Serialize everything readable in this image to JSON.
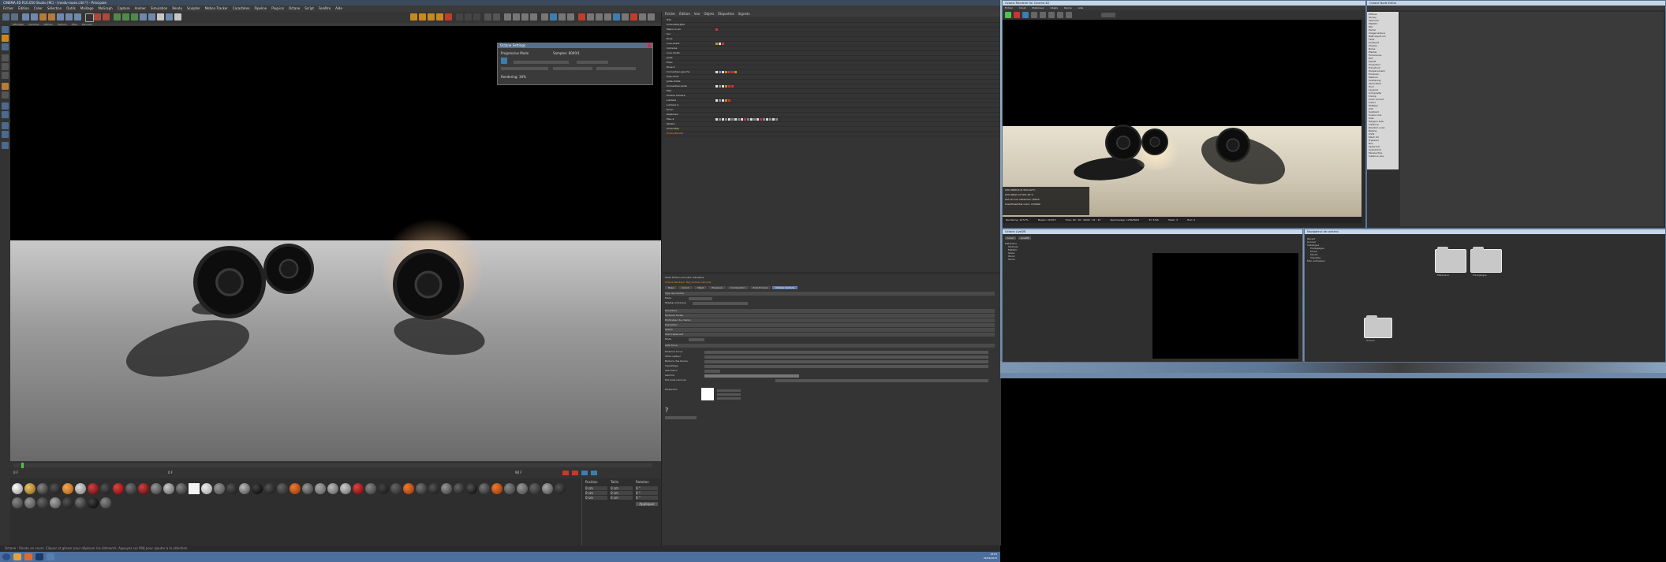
{
  "c4d": {
    "title": "CINEMA 4D R16.050 Studio (RC) - [rendu-roues.c4d *] - Principale",
    "menu": [
      "Fichier",
      "Édition",
      "Créer",
      "Sélection",
      "Outils",
      "Maillage",
      "MoGraph",
      "Capture",
      "Animer",
      "Simulation",
      "Rendu",
      "Sculpter",
      "Motion Tracker",
      "Caractères",
      "Pipeline",
      "Plug-ins",
      "Octane",
      "Script",
      "Fenêtre",
      "Aide"
    ],
    "viewport_menu": [
      "Affichage",
      "Caméras",
      "Afficher",
      "Options",
      "Filtre",
      "Panneau"
    ],
    "status": "Octane : Rendu en cours. Cliquer et glisser pour déplacer les éléments. Appuyez sur MAJ pour ajouter à la sélection.",
    "colors": {
      "accent": "#4d6a8c",
      "taskbar": "#4c6f9e"
    }
  },
  "render_dialog": {
    "title": "Octane Settings",
    "line1": "Progressive Mode",
    "line2": "Samples: 8000/1",
    "status": "Rendering: 30%"
  },
  "objects": {
    "menu": [
      "Fichier",
      "Édition",
      "Vue",
      "Objets",
      "Étiquettes",
      "Signets"
    ],
    "rows": [
      "Hdri",
      "OctaneDaylight",
      "Mains-ro-arr",
      "Sol",
      "Roue",
      "roue-avant",
      "Cameras",
      "roue-droite",
      "Jante",
      "Pneu",
      "Roue-2",
      "Connecteur-gauche",
      "Pneu-droit",
      "Jante-droite",
      "Connecteur-jante",
      "Plan",
      "Octane Camera",
      "Lumiere",
      "Lumiere-2",
      "Ecran",
      "Reflecteur",
      "Plan-2",
      "Sphere",
      "OctaneSky",
      "OctaneRender"
    ]
  },
  "attributes": {
    "header": "Mode   Édition   Données utilisateur",
    "title": "Octane Renderer Tag [Octane Camera]",
    "tabs": [
      "Base",
      "Coord.",
      "Objet",
      "Physique",
      "Composition",
      "Post-Process",
      "Octane Camera"
    ],
    "rows": [
      "Type de caméra",
      "Mode",
      "Réglage physique",
      "Ouverture",
      "Distance focale",
      "Profondeur de champ",
      "Exposition",
      "Stéréo",
      "Post traitement",
      "Mode",
      "Auto focus",
      "Distance focus",
      "Taille capteur",
      "Balance des blancs",
      "Vignettage",
      "Saturation",
      "Gamma",
      "Hot pixel removal",
      "Dispersion"
    ],
    "help_mark": "?"
  },
  "timeline": {
    "start": "0 F",
    "end": "90 F",
    "current": "0 F"
  },
  "coords": {
    "headers": [
      "Position",
      "Taille",
      "Rotation"
    ],
    "x": [
      "0 cm",
      "0 cm",
      "0 °"
    ],
    "y": [
      "0 cm",
      "0 cm",
      "0 °"
    ],
    "z": [
      "0 cm",
      "0 cm",
      "0 °"
    ],
    "apply": "Appliquer"
  },
  "taskbar": {
    "time": "18:04",
    "date": "22/04/2015"
  },
  "live_viewer": {
    "title": "Octane Renderer for Cinema 4D",
    "menu": [
      "Fichier",
      "Cloud",
      "Matériaux",
      "Objets",
      "Rendu",
      "Aide"
    ],
    "stats": [
      "GTX 980Ti(3.0)    54%   62°C",
      "GTX 980(1.2)      54%   61°C",
      "Out-of-core used/max: 0/0Gb",
      "Used/free/total vram: 2/4/6Gb"
    ],
    "stat_bar": [
      "Rendering: 16.57%",
      "Ms/sec: 26.873",
      "Time: 00 : 00 : 08/00 : 01 : 25",
      "Spp/maxspp: 1280/8000",
      "Tri: 572k",
      "Mesh: 3",
      "Hair: 0"
    ]
  },
  "node_manager": {
    "title": "Octane Node Editor",
    "items": [
      "Diffuse",
      "Glossy",
      "Specular",
      "Metallic",
      "Mix",
      "Portal",
      "Image texture",
      "RGB spectrum",
      "Float",
      "Gradient",
      "Checks",
      "Noise",
      "Marble",
      "Turbulence",
      "Dirt",
      "Falloff",
      "Projection",
      "Transform",
      "Displacement",
      "Emission",
      "Medium",
      "Scattering",
      "Absorption",
      "Toon",
      "Layered",
      "Composite",
      "Clamp",
      "Color correct",
      "Invert",
      "Multiply",
      "Add",
      "Subtract",
      "Cosine mix",
      "Side",
      "Polygon side",
      "Instance",
      "Random color",
      "Baking",
      "UVW",
      "Mesh UV",
      "Triplanar",
      "Box",
      "Spherical",
      "Cylindrical",
      "Perspective",
      "Instance pos"
    ]
  },
  "octane_materials": {
    "title": "Octane LiveDB",
    "tabs": [
      "Local",
      "LiveDB"
    ],
    "tree": [
      "Matériaux",
      "Textures",
      "Metallic",
      "Glass",
      "Wood",
      "Stone"
    ]
  },
  "content_browser": {
    "title": "Navigateur de contenu",
    "tree": [
      "Récent",
      "Accueil",
      "Catalogue",
      "Préréglages",
      "Prime",
      "Studio",
      "Visualize",
      "Mon ordinateur"
    ],
    "folders": [
      "Matériaux",
      "Préréglages",
      "Octane"
    ]
  }
}
